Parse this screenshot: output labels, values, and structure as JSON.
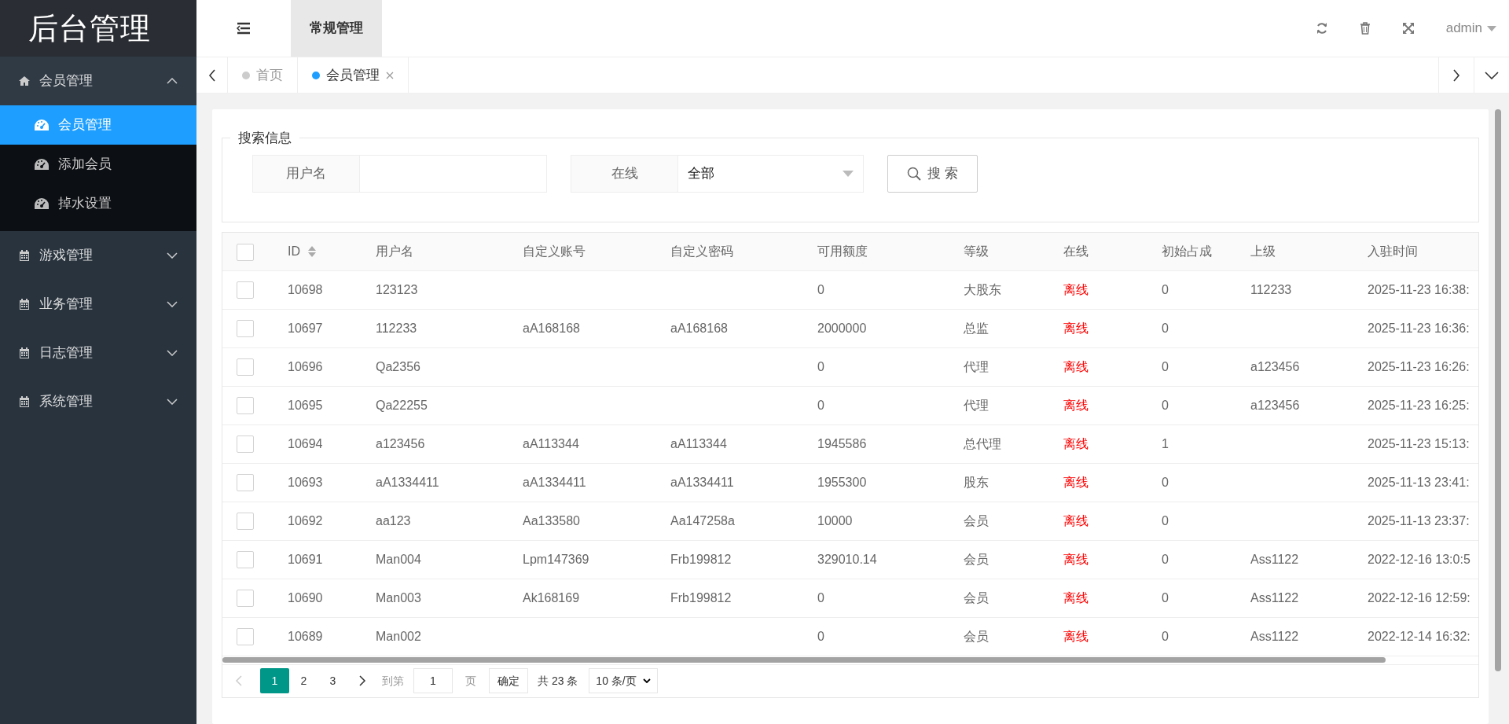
{
  "logo": "后台管理",
  "sidebar": [
    {
      "label": "会员管理",
      "expanded": true,
      "children": [
        {
          "label": "会员管理",
          "selected": true
        },
        {
          "label": "添加会员",
          "selected": false
        },
        {
          "label": "掉水设置",
          "selected": false
        }
      ]
    },
    {
      "label": "游戏管理",
      "expanded": false
    },
    {
      "label": "业务管理",
      "expanded": false
    },
    {
      "label": "日志管理",
      "expanded": false
    },
    {
      "label": "系统管理",
      "expanded": false
    }
  ],
  "header": {
    "nav": [
      {
        "label": "常规管理",
        "selected": true
      }
    ],
    "user": "admin"
  },
  "tabs": [
    {
      "label": "首页",
      "selected": false,
      "closable": false
    },
    {
      "label": "会员管理",
      "selected": true,
      "closable": true
    }
  ],
  "search": {
    "legend": "搜索信息",
    "fields": [
      {
        "kind": "input",
        "label": "用户名"
      },
      {
        "kind": "select",
        "label": "在线",
        "value": "全部"
      }
    ],
    "button": "搜 索"
  },
  "table": {
    "all_checked": false,
    "columns": [
      "ID",
      "用户名",
      "自定义账号",
      "自定义密码",
      "可用额度",
      "等级",
      "在线",
      "初始占成",
      "上级",
      "入驻时间"
    ],
    "rows": [
      {
        "checked": false,
        "cells": [
          "10698",
          "123123",
          null,
          null,
          "0",
          "大股东",
          "离线",
          "0",
          "112233",
          "2025-11-23 16:38:"
        ]
      },
      {
        "checked": false,
        "cells": [
          "10697",
          "112233",
          "aA168168",
          "aA168168",
          "2000000",
          "总监",
          "离线",
          "0",
          null,
          "2025-11-23 16:36:"
        ]
      },
      {
        "checked": false,
        "cells": [
          "10696",
          "Qa2356",
          null,
          null,
          "0",
          "代理",
          "离线",
          "0",
          "a123456",
          "2025-11-23 16:26:"
        ]
      },
      {
        "checked": false,
        "cells": [
          "10695",
          "Qa22255",
          null,
          null,
          "0",
          "代理",
          "离线",
          "0",
          "a123456",
          "2025-11-23 16:25:"
        ]
      },
      {
        "checked": false,
        "cells": [
          "10694",
          "a123456",
          "aA113344",
          "aA113344",
          "1945586",
          "总代理",
          "离线",
          "1",
          null,
          "2025-11-23 15:13:"
        ]
      },
      {
        "checked": false,
        "cells": [
          "10693",
          "aA1334411",
          "aA1334411",
          "aA1334411",
          "1955300",
          "股东",
          "离线",
          "0",
          null,
          "2025-11-13 23:41:"
        ]
      },
      {
        "checked": false,
        "cells": [
          "10692",
          "aa123",
          "Aa133580",
          "Aa147258a",
          "10000",
          "会员",
          "离线",
          "0",
          null,
          "2025-11-13 23:37:"
        ]
      },
      {
        "checked": false,
        "cells": [
          "10691",
          "Man004",
          "Lpm147369",
          "Frb199812",
          "329010.14",
          "会员",
          "离线",
          "0",
          "Ass1122",
          "2022-12-16 13:0:5"
        ]
      },
      {
        "checked": false,
        "cells": [
          "10690",
          "Man003",
          "Ak168169",
          "Frb199812",
          "0",
          "会员",
          "离线",
          "0",
          "Ass1122",
          "2022-12-16 12:59:"
        ]
      },
      {
        "checked": false,
        "cells": [
          "10689",
          "Man002",
          null,
          null,
          "0",
          "会员",
          "离线",
          "0",
          "Ass1122",
          "2022-12-14 16:32:"
        ]
      }
    ]
  },
  "pagination": {
    "pages": [
      {
        "label": "1",
        "selected": true
      },
      {
        "label": "2",
        "selected": false
      },
      {
        "label": "3",
        "selected": false
      }
    ],
    "goto_label": "到第",
    "goto_value": "1",
    "page_unit": "页",
    "confirm": "确定",
    "total": "共 23 条",
    "page_size": "10 条/页"
  }
}
